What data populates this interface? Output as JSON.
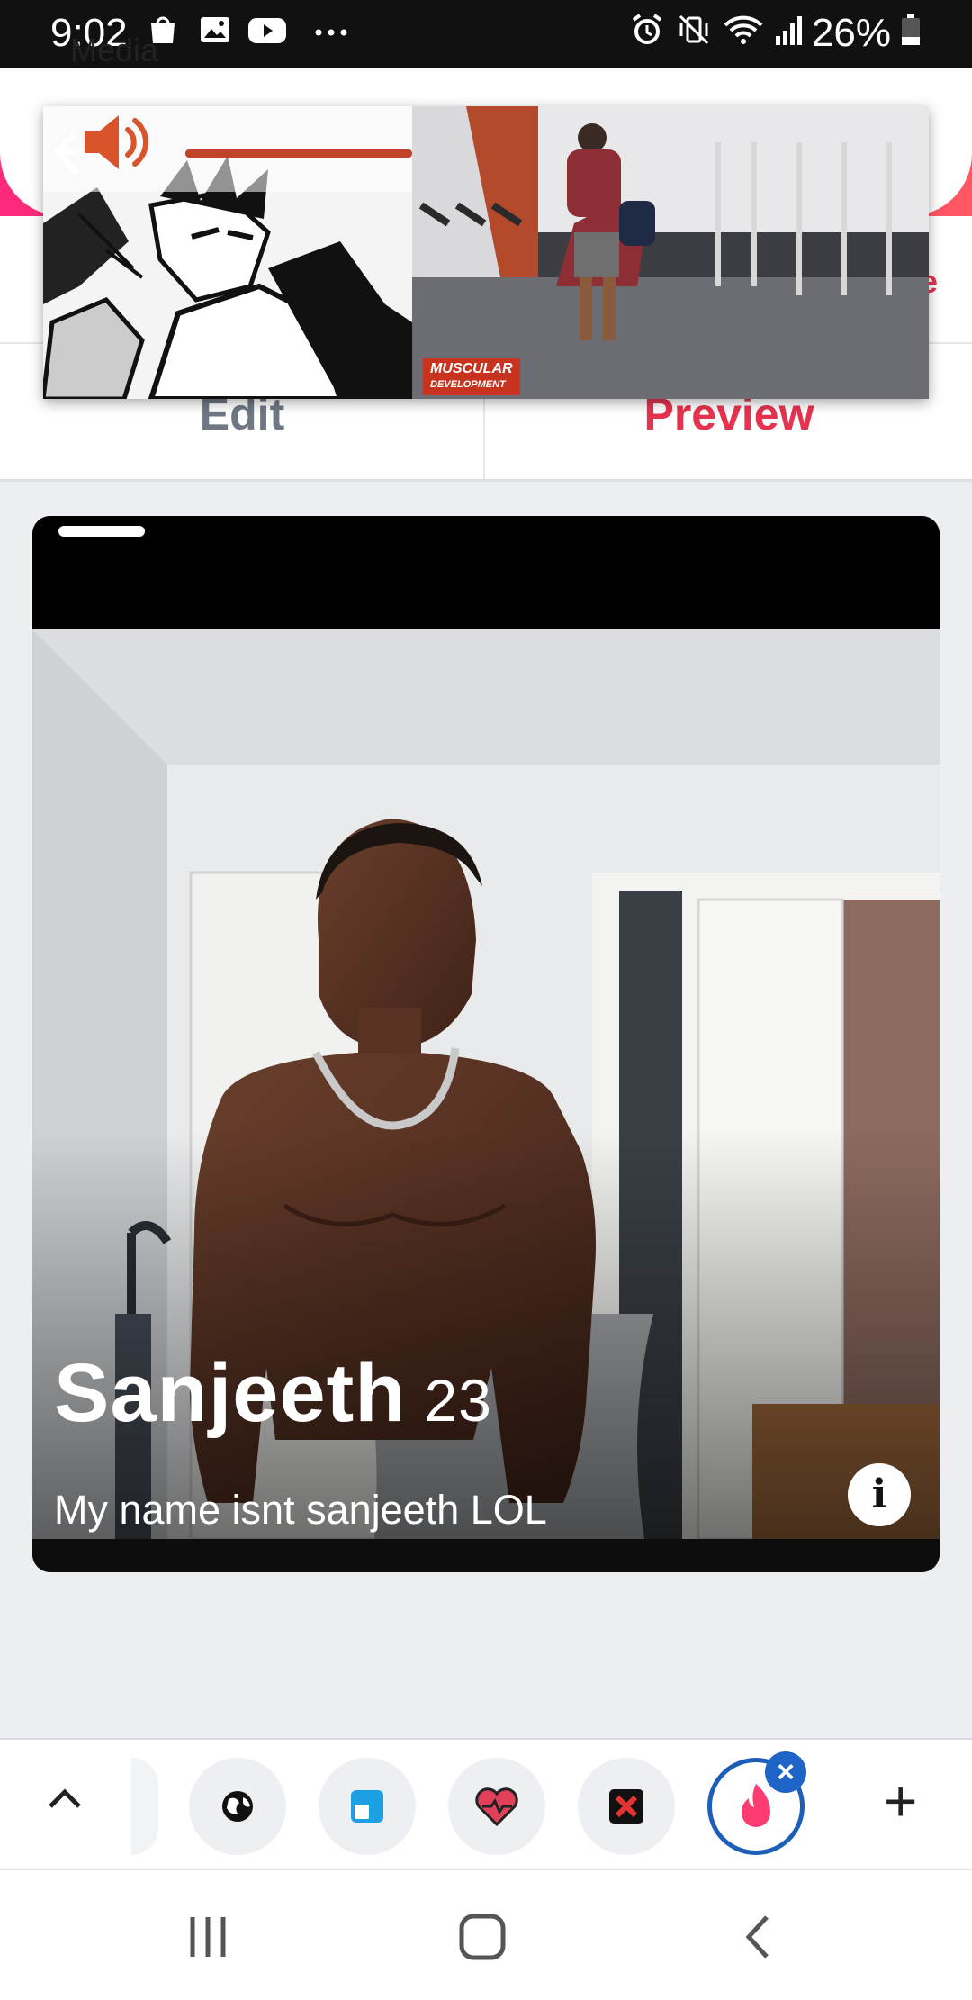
{
  "status_bar": {
    "time": "9:02",
    "battery_percent": "26%",
    "left_icons": [
      "shopping-bag-icon",
      "image-icon",
      "youtube-icon",
      "more-dots-icon"
    ],
    "right_icons": [
      "alarm-icon",
      "vibrate-mute-icon",
      "wifi-icon",
      "signal-icon",
      "battery-icon"
    ]
  },
  "header": {
    "title": "Media"
  },
  "tabs": {
    "edit": "Edit",
    "preview": "Preview",
    "active": "Preview"
  },
  "media_overlay": {
    "logo_line1": "MUSCULAR",
    "logo_line2": "DEVELOPMENT"
  },
  "profile": {
    "name": "Sanjeeth",
    "age": "23",
    "bio": "My name isnt sanjeeth LOL"
  },
  "tray": {
    "apps": [
      "earth-app-icon",
      "blue-app-icon",
      "heart-app-icon",
      "x-app-icon",
      "tinder-flame-icon"
    ]
  },
  "colors": {
    "brand_gradient_start": "#fd297b",
    "brand_gradient_end": "#ff5864",
    "preview_tab": "#e6334f",
    "edit_tab": "#6f7784",
    "active_ring": "#1d5fb8"
  }
}
